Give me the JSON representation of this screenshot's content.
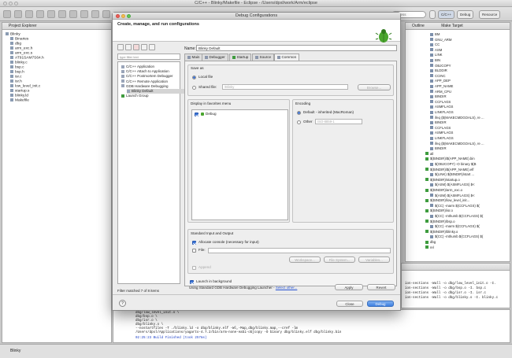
{
  "window": {
    "title": "C/C++ - Blinky/Makefile - Eclipse - /Users/dpxl/work/Arm/eclipse"
  },
  "toolbar": {
    "quick_access": "Access",
    "perspectives": [
      "C/C++",
      "Debug",
      "Resource"
    ]
  },
  "project_explorer": {
    "tab": "Project Explorer",
    "items": [
      {
        "label": "Blinky",
        "level": 0
      },
      {
        "label": "Binaries",
        "level": 1
      },
      {
        "label": "dbg",
        "level": 1
      },
      {
        "label": "arm_exc.h",
        "level": 1
      },
      {
        "label": "arm_exc.s",
        "level": 1
      },
      {
        "label": "AT91SAM7S64.h",
        "level": 1
      },
      {
        "label": "blinky.c",
        "level": 1
      },
      {
        "label": "bsp.c",
        "level": 1
      },
      {
        "label": "bsp.h",
        "level": 1
      },
      {
        "label": "isr.c",
        "level": 1
      },
      {
        "label": "isr.h",
        "level": 1
      },
      {
        "label": "low_level_init.c",
        "level": 1
      },
      {
        "label": "startup.s",
        "level": 1
      },
      {
        "label": "blinky.ld",
        "level": 1
      },
      {
        "label": "Makefile",
        "level": 1
      }
    ]
  },
  "outline": {
    "tabs": [
      "Outline",
      "Make Target"
    ],
    "items": [
      {
        "label": "BM",
        "green": false
      },
      {
        "label": "GNU_ARM",
        "green": false
      },
      {
        "label": "CC",
        "green": false
      },
      {
        "label": "ASM",
        "green": false
      },
      {
        "label": "LINK",
        "green": false
      },
      {
        "label": "BIN",
        "green": false
      },
      {
        "label": "OBJCOPY",
        "green": false
      },
      {
        "label": "BLDDIR",
        "green": false
      },
      {
        "label": "CCINC",
        "green": false
      },
      {
        "label": "APP_DEP",
        "green": false
      },
      {
        "label": "APP_NAME",
        "green": false
      },
      {
        "label": "ARM_CPU",
        "green": false
      },
      {
        "label": "BINDIR",
        "green": false
      },
      {
        "label": "CCFLAGS",
        "green": false
      },
      {
        "label": "ASMFLAGS",
        "green": false
      },
      {
        "label": "LINKFLAGS",
        "green": false
      },
      {
        "label": "ifeq ($(MAKECMDGOALS), re ...",
        "green": false
      },
      {
        "label": "BINDIR",
        "green": false
      },
      {
        "label": "CCFLAGS",
        "green": false
      },
      {
        "label": "ASMFLAGS",
        "green": false
      },
      {
        "label": "LINKFLAGS",
        "green": false
      },
      {
        "label": "ifeq ($(MAKECMDGOALS), re ...",
        "green": false
      },
      {
        "label": "BINDIR",
        "green": false
      },
      {
        "label": "all",
        "green": true
      },
      {
        "label": "$(BINDIR)/$(APP_NAME).bin",
        "green": true
      },
      {
        "label": "$(OBJCOPY) -O binary $(B",
        "green": false
      },
      {
        "label": "$(BINDIR)/$(APP_NAME).elf",
        "green": true
      },
      {
        "label": "$(LINK) $(BINDIR)/start ...",
        "green": false
      },
      {
        "label": "$(BINDIR)/startup.o",
        "green": true
      },
      {
        "label": "$(ASM) $(ASMFLAGS) $<",
        "green": false
      },
      {
        "label": "$(BINDIR)/arm_exc.o",
        "green": true
      },
      {
        "label": "$(ASM) $(ASMFLAGS) $<",
        "green": false
      },
      {
        "label": "$(BINDIR)/low_level_init...",
        "green": true
      },
      {
        "label": "$(CC) -marm $(CCFLAGS) $(",
        "green": false
      },
      {
        "label": "$(BINDIR)/isr.o",
        "green": true
      },
      {
        "label": "$(CC) -mthumb $(CCFLAGS) $(",
        "green": false
      },
      {
        "label": "$(BINDIR)/bsp.o",
        "green": true
      },
      {
        "label": "$(CC) -marm $(CCFLAGS) $(",
        "green": false
      },
      {
        "label": "$(BINDIR)/blinky.o",
        "green": true
      },
      {
        "label": "$(CC) -mthumb $(CCFLAGS) $(",
        "green": false
      },
      {
        "label": "dbg",
        "green": true
      },
      {
        "label": "rel",
        "green": true
      }
    ]
  },
  "console": {
    "right_lines": [
      "ion-sections -Wall -o dbg/low_level_init.o -I.",
      "ion-sections -Wall -o dbg/bsp.o -I. bsp.c",
      "ion-sections -Wall -o dbg/isr.o -I. isr.c",
      "ion-sections -Wall -o dbg/blinky.o -I. blinky.c"
    ],
    "bottom_lines": [
      "dbg/low_level_init.o \\",
      "dbg/bsp.o \\",
      "dbg/isr.o \\",
      "dbg/blinky.o \\",
      "--nostartfiles -T ./blinky.ld -o dbg/blinky.elf -Wl,-Map,dbg/blinky.map,--cref -lm",
      "/Users/dpxl/Applications/yagarto-4.7.2/bin/arm-none-eabi-objcopy -O binary dbg/blinky.elf dbg/blinky.bin"
    ],
    "finished": "02:25:23 Build Finished (took 257ms)"
  },
  "status_bar": {
    "label": "Blinky"
  },
  "dialog": {
    "title": "Debug Configurations",
    "heading": "Create, manage, and run configurations",
    "filter_placeholder": "type filter text",
    "tree": [
      {
        "label": "C/C++ Application",
        "level": 0,
        "green": false
      },
      {
        "label": "C/C++ Attach to Application",
        "level": 0,
        "green": false
      },
      {
        "label": "C/C++ Postmortem Debugger",
        "level": 0,
        "green": false
      },
      {
        "label": "C/C++ Remote Application",
        "level": 0,
        "green": false
      },
      {
        "label": "GDB Hardware Debugging",
        "level": 0,
        "green": false
      },
      {
        "label": "Blinky Default",
        "level": 1,
        "green": false
      },
      {
        "label": "Launch Group",
        "level": 0,
        "green": true
      }
    ],
    "filter_status": "Filter matched 7 of 8 items",
    "name_label": "Name:",
    "name_value": "Blinky Default",
    "tabs": [
      "Main",
      "Debugger",
      "Startup",
      "Source",
      "Common"
    ],
    "save_as": {
      "label": "Save as",
      "local": "Local file",
      "shared": "Shared file:",
      "shared_value": "/Blinky",
      "browse": "Browse..."
    },
    "favorites": {
      "label": "Display in favorites menu",
      "items": [
        "Debug"
      ]
    },
    "encoding": {
      "label": "Encoding",
      "default": "Default - inherited (MacRoman)",
      "other": "Other",
      "other_value": "ISO-8859-1"
    },
    "stdio": {
      "label": "Standard Input and Output",
      "allocate": "Allocate console (necessary for input)",
      "file": "File:",
      "workspace": "Workspace...",
      "file_system": "File System...",
      "variables": "Variables...",
      "append": "Append"
    },
    "background": "Launch in background",
    "launcher_text": "Using Standard GDB Hardware Debugging Launcher -",
    "launcher_link": "Select other...",
    "apply": "Apply",
    "revert": "Revert",
    "close": "Close",
    "debug": "Debug"
  }
}
